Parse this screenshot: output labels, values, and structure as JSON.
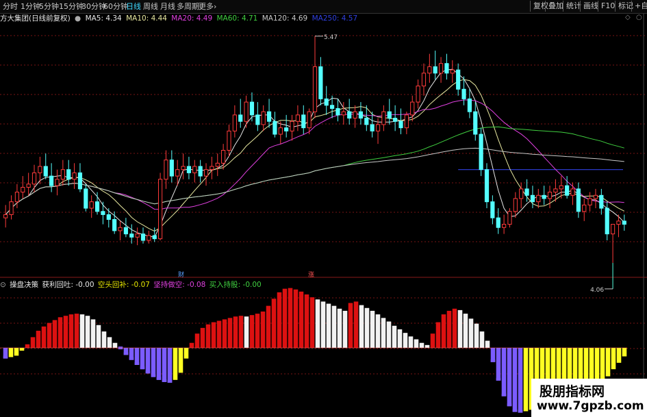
{
  "toolbar": {
    "periods": [
      "分时",
      "1分钟",
      "5分钟",
      "15分钟",
      "30分钟",
      "60分钟",
      "日线",
      "周线",
      "月线",
      "多周期",
      "更多"
    ],
    "more_arrow": "›",
    "active_period": "日线",
    "tools": [
      "复权",
      "叠加",
      "统计",
      "画线",
      "F10",
      "标记",
      "+自选"
    ]
  },
  "info": {
    "stock": "方大集团(日线前复权)",
    "ma": [
      {
        "label": "MA5: 4.34",
        "color": "#e8e8e8"
      },
      {
        "label": "MA10: 4.44",
        "color": "#e8e8a0"
      },
      {
        "label": "MA20: 4.49",
        "color": "#e040e0"
      },
      {
        "label": "MA60: 4.71",
        "color": "#40d040"
      },
      {
        "label": "MA120: 4.69",
        "color": "#c8c8c8"
      },
      {
        "label": "MA250: 4.57",
        "color": "#3040e0"
      }
    ]
  },
  "sub_info": {
    "name": "操盘决策",
    "items": [
      {
        "label": "获利回吐: -0.00",
        "color": "#e8e8e8"
      },
      {
        "label": "空头回补: -0.07",
        "color": "#e8e800"
      },
      {
        "label": "坚持做空: -0.08",
        "color": "#e040e0"
      },
      {
        "label": "买入持股: -0.00",
        "color": "#40d040"
      }
    ]
  },
  "annotations": {
    "high": "5.47",
    "low": "4.06",
    "badge1": "财",
    "badge2": "涨"
  },
  "colors": {
    "up": "#ff3b3b",
    "down": "#54ffff",
    "bar_red": "#dd1111",
    "bar_white": "#f2f2f2",
    "bar_purple": "#7b5cff",
    "bar_yellow": "#ffff22",
    "grid": "#7a1414"
  },
  "chart_data": [
    {
      "type": "candlestick",
      "title": "方大集团(日线前复权)",
      "ohlc": [
        [
          4.34,
          4.42,
          4.28,
          4.36
        ],
        [
          4.36,
          4.48,
          4.33,
          4.44
        ],
        [
          4.44,
          4.55,
          4.4,
          4.5
        ],
        [
          4.5,
          4.6,
          4.46,
          4.53
        ],
        [
          4.53,
          4.62,
          4.48,
          4.55
        ],
        [
          4.55,
          4.67,
          4.5,
          4.62
        ],
        [
          4.62,
          4.72,
          4.55,
          4.66
        ],
        [
          4.66,
          4.74,
          4.58,
          4.6
        ],
        [
          4.6,
          4.68,
          4.5,
          4.54
        ],
        [
          4.54,
          4.64,
          4.48,
          4.58
        ],
        [
          4.58,
          4.7,
          4.54,
          4.64
        ],
        [
          4.64,
          4.7,
          4.54,
          4.58
        ],
        [
          4.58,
          4.68,
          4.52,
          4.62
        ],
        [
          4.62,
          4.68,
          4.5,
          4.52
        ],
        [
          4.52,
          4.55,
          4.38,
          4.4
        ],
        [
          4.4,
          4.48,
          4.34,
          4.44
        ],
        [
          4.44,
          4.5,
          4.36,
          4.38
        ],
        [
          4.38,
          4.44,
          4.3,
          4.36
        ],
        [
          4.36,
          4.4,
          4.28,
          4.33
        ],
        [
          4.33,
          4.38,
          4.24,
          4.26
        ],
        [
          4.26,
          4.32,
          4.2,
          4.28
        ],
        [
          4.28,
          4.34,
          4.22,
          4.24
        ],
        [
          4.24,
          4.3,
          4.18,
          4.22
        ],
        [
          4.22,
          4.28,
          4.17,
          4.24
        ],
        [
          4.24,
          4.28,
          4.18,
          4.2
        ],
        [
          4.2,
          4.26,
          4.18,
          4.23
        ],
        [
          4.23,
          4.28,
          4.19,
          4.21
        ],
        [
          4.21,
          4.62,
          4.2,
          4.58
        ],
        [
          4.58,
          4.76,
          4.52,
          4.7
        ],
        [
          4.7,
          4.76,
          4.56,
          4.6
        ],
        [
          4.6,
          4.7,
          4.54,
          4.64
        ],
        [
          4.64,
          4.74,
          4.58,
          4.66
        ],
        [
          4.66,
          4.72,
          4.58,
          4.62
        ],
        [
          4.62,
          4.7,
          4.56,
          4.66
        ],
        [
          4.66,
          4.7,
          4.56,
          4.6
        ],
        [
          4.6,
          4.68,
          4.54,
          4.64
        ],
        [
          4.64,
          4.72,
          4.58,
          4.66
        ],
        [
          4.66,
          4.74,
          4.6,
          4.68
        ],
        [
          4.68,
          4.8,
          4.64,
          4.76
        ],
        [
          4.76,
          4.92,
          4.72,
          4.88
        ],
        [
          4.88,
          5.04,
          4.84,
          4.98
        ],
        [
          4.98,
          5.08,
          4.9,
          4.94
        ],
        [
          4.94,
          5.1,
          4.9,
          5.06
        ],
        [
          5.06,
          5.12,
          4.94,
          4.98
        ],
        [
          4.98,
          5.06,
          4.88,
          4.92
        ],
        [
          4.92,
          5.04,
          4.88,
          5.0
        ],
        [
          5.0,
          5.08,
          4.9,
          4.94
        ],
        [
          4.94,
          5.0,
          4.84,
          4.86
        ],
        [
          4.86,
          4.94,
          4.8,
          4.9
        ],
        [
          4.9,
          4.98,
          4.84,
          4.88
        ],
        [
          4.88,
          4.98,
          4.82,
          4.94
        ],
        [
          4.94,
          5.04,
          4.88,
          4.98
        ],
        [
          4.98,
          5.04,
          4.86,
          4.9
        ],
        [
          4.9,
          5.02,
          4.86,
          5.0
        ],
        [
          5.0,
          5.47,
          4.96,
          5.28
        ],
        [
          5.28,
          5.34,
          5.04,
          5.08
        ],
        [
          5.08,
          5.16,
          4.98,
          5.04
        ],
        [
          5.04,
          5.1,
          4.96,
          5.02
        ],
        [
          5.02,
          5.08,
          4.94,
          4.98
        ],
        [
          4.98,
          5.06,
          4.92,
          5.0
        ],
        [
          5.0,
          5.08,
          4.92,
          4.96
        ],
        [
          4.96,
          5.04,
          4.9,
          5.0
        ],
        [
          5.0,
          5.06,
          4.92,
          4.96
        ],
        [
          4.96,
          5.04,
          4.88,
          4.92
        ],
        [
          4.92,
          5.0,
          4.84,
          4.88
        ],
        [
          4.88,
          4.96,
          4.8,
          4.92
        ],
        [
          4.92,
          5.04,
          4.88,
          5.0
        ],
        [
          5.0,
          5.08,
          4.92,
          4.96
        ],
        [
          4.96,
          5.04,
          4.88,
          4.94
        ],
        [
          4.94,
          5.02,
          4.86,
          4.9
        ],
        [
          4.9,
          5.0,
          4.86,
          4.98
        ],
        [
          4.98,
          5.1,
          4.94,
          5.06
        ],
        [
          5.06,
          5.2,
          5.02,
          5.16
        ],
        [
          5.16,
          5.3,
          5.1,
          5.24
        ],
        [
          5.24,
          5.36,
          5.18,
          5.28
        ],
        [
          5.28,
          5.38,
          5.2,
          5.24
        ],
        [
          5.24,
          5.34,
          5.18,
          5.3
        ],
        [
          5.3,
          5.36,
          5.2,
          5.24
        ],
        [
          5.24,
          5.32,
          5.18,
          5.26
        ],
        [
          5.26,
          5.3,
          5.1,
          5.14
        ],
        [
          5.14,
          5.22,
          5.04,
          5.08
        ],
        [
          5.08,
          5.14,
          4.96,
          5.0
        ],
        [
          5.0,
          5.06,
          4.82,
          4.86
        ],
        [
          4.86,
          4.9,
          4.6,
          4.64
        ],
        [
          4.64,
          4.68,
          4.4,
          4.44
        ],
        [
          4.44,
          4.48,
          4.3,
          4.34
        ],
        [
          4.34,
          4.4,
          4.24,
          4.28
        ],
        [
          4.28,
          4.36,
          4.24,
          4.3
        ],
        [
          4.3,
          4.4,
          4.28,
          4.38
        ],
        [
          4.38,
          4.5,
          4.34,
          4.46
        ],
        [
          4.46,
          4.56,
          4.4,
          4.52
        ],
        [
          4.52,
          4.58,
          4.44,
          4.48
        ],
        [
          4.48,
          4.54,
          4.4,
          4.44
        ],
        [
          4.44,
          4.52,
          4.4,
          4.48
        ],
        [
          4.48,
          4.54,
          4.42,
          4.46
        ],
        [
          4.46,
          4.54,
          4.4,
          4.5
        ],
        [
          4.5,
          4.58,
          4.44,
          4.52
        ],
        [
          4.52,
          4.6,
          4.46,
          4.54
        ],
        [
          4.54,
          4.6,
          4.46,
          4.48
        ],
        [
          4.48,
          4.56,
          4.42,
          4.52
        ],
        [
          4.52,
          4.56,
          4.34,
          4.38
        ],
        [
          4.38,
          4.46,
          4.32,
          4.42
        ],
        [
          4.42,
          4.5,
          4.38,
          4.46
        ],
        [
          4.46,
          4.52,
          4.4,
          4.48
        ],
        [
          4.48,
          4.52,
          4.36,
          4.4
        ],
        [
          4.4,
          4.44,
          4.2,
          4.24
        ],
        [
          4.24,
          4.28,
          4.06,
          4.3
        ],
        [
          4.3,
          4.36,
          4.22,
          4.32
        ],
        [
          4.32,
          4.36,
          4.26,
          4.3
        ]
      ],
      "ma_lines": {
        "MA5": [
          4.37,
          4.42,
          4.47,
          4.53,
          4.58,
          4.6,
          4.56,
          4.55,
          4.53,
          4.55,
          4.58,
          4.52,
          4.46,
          4.4,
          4.36,
          4.32,
          4.28,
          4.25,
          4.24,
          4.23,
          4.3,
          4.4,
          4.5,
          4.6,
          4.64,
          4.64,
          4.65,
          4.7,
          4.8,
          4.9,
          4.96,
          4.98,
          4.97,
          4.96,
          4.95,
          4.95,
          4.96,
          4.97,
          4.98,
          5.04,
          5.08,
          5.06,
          5.02,
          4.99,
          4.96,
          4.94,
          4.92,
          4.94,
          4.97,
          5.06,
          5.16,
          5.24,
          5.26,
          5.27,
          5.2,
          5.1,
          4.96,
          4.78,
          4.6,
          4.45,
          4.36,
          4.34,
          4.38,
          4.43,
          4.46,
          4.48,
          4.5,
          4.52,
          4.48,
          4.44,
          4.42,
          4.4,
          4.36,
          4.3,
          4.28
        ],
        "MA250": [
          4.64
        ]
      },
      "ylim": [
        4.0,
        5.55
      ],
      "annotations": [
        "5.47",
        "4.06"
      ]
    },
    {
      "type": "bar",
      "title": "操盘决策",
      "values": [
        -0.3,
        -0.26,
        -0.22,
        -0.08,
        0.1,
        0.3,
        0.48,
        0.6,
        0.7,
        0.78,
        0.86,
        0.9,
        0.94,
        0.96,
        0.94,
        0.9,
        0.8,
        0.64,
        0.46,
        0.3,
        0.14,
        -0.04,
        -0.2,
        -0.34,
        -0.48,
        -0.6,
        -0.72,
        -0.82,
        -0.9,
        -0.96,
        -0.98,
        -0.9,
        -0.7,
        -0.3,
        0.14,
        0.4,
        0.56,
        0.66,
        0.72,
        0.76,
        0.8,
        0.84,
        0.88,
        0.9,
        0.88,
        0.92,
        0.96,
        1.02,
        1.18,
        1.38,
        1.56,
        1.66,
        1.68,
        1.64,
        1.58,
        1.5,
        1.42,
        1.36,
        1.3,
        1.24,
        1.18,
        1.1,
        1.04,
        1.26,
        1.3,
        1.2,
        1.12,
        1.04,
        0.94,
        0.84,
        0.74,
        0.62,
        0.52,
        0.42,
        0.32,
        0.24,
        0.14,
        0.08,
        0.4,
        0.72,
        0.94,
        1.04,
        1.1,
        1.06,
        0.96,
        0.82,
        0.68,
        0.46,
        0.2,
        -0.4,
        -0.92,
        -1.36,
        -1.64,
        -1.8,
        -1.82,
        -1.78,
        -1.74,
        -1.66,
        -1.58,
        -1.52,
        -1.4,
        -1.3,
        -1.24,
        -1.2,
        -1.18,
        -1.14,
        -1.1,
        -1.06,
        -1.0,
        -0.94,
        -0.8,
        -0.6,
        -0.42,
        -0.24
      ]
    }
  ]
}
